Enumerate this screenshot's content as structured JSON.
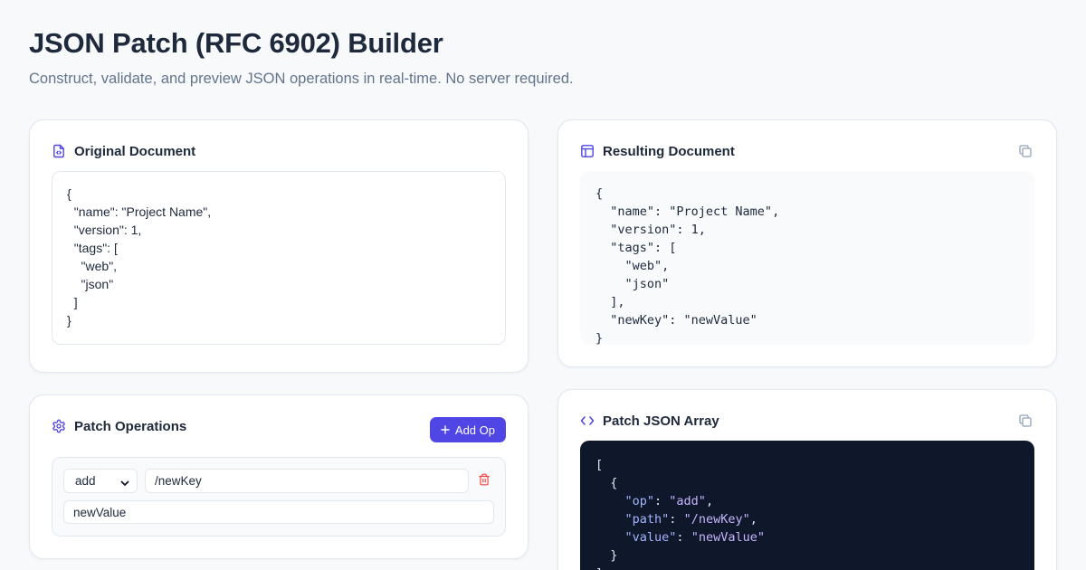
{
  "header": {
    "title": "JSON Patch (RFC 6902) Builder",
    "subtitle": "Construct, validate, and preview JSON operations in real-time. No server required."
  },
  "original": {
    "title": "Original Document",
    "content": "{\n  \"name\": \"Project Name\",\n  \"version\": 1,\n  \"tags\": [\n    \"web\",\n    \"json\"\n  ]\n}"
  },
  "operations": {
    "title": "Patch Operations",
    "add_label": "Add Op",
    "items": [
      {
        "op": "add",
        "path": "/newKey",
        "value": "newValue"
      }
    ]
  },
  "result": {
    "title": "Resulting Document",
    "content": "{\n  \"name\": \"Project Name\",\n  \"version\": 1,\n  \"tags\": [\n    \"web\",\n    \"json\"\n  ],\n  \"newKey\": \"newValue\"\n}"
  },
  "patch": {
    "title": "Patch JSON Array",
    "lines": [
      {
        "t": "["
      },
      {
        "t": "  {"
      },
      {
        "k": "op",
        "v": "add",
        "indent": "    ",
        "comma": true
      },
      {
        "k": "path",
        "v": "/newKey",
        "indent": "    ",
        "comma": true
      },
      {
        "k": "value",
        "v": "newValue",
        "indent": "    ",
        "comma": false
      },
      {
        "t": "  }"
      },
      {
        "t": "]"
      }
    ]
  },
  "colors": {
    "accent": "#4f46e5",
    "danger": "#ef4444",
    "code_bg": "#0f172a"
  },
  "icons": {
    "original": "file-code-icon",
    "result": "layout-icon",
    "operations": "gear-icon",
    "patch": "code-icon",
    "copy": "copy-icon",
    "delete": "trash-icon",
    "add": "plus-icon"
  }
}
